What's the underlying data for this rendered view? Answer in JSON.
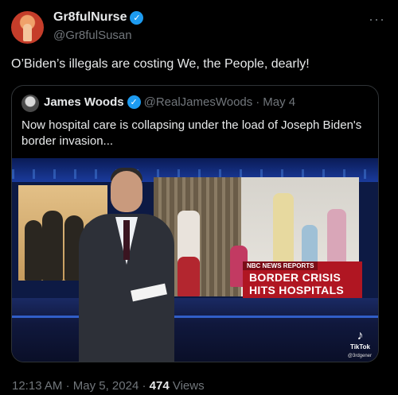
{
  "post": {
    "display_name": "Gr8fulNurse",
    "handle": "@Gr8fulSusan",
    "text": "O’Biden’s illegals are costing We, the People, dearly!",
    "more_icon": "more-dots-icon",
    "verified_icon": "verified-badge-icon",
    "time": "12:13 AM",
    "date": "May 5, 2024",
    "separator": "·",
    "views_count": "474",
    "views_label": "Views"
  },
  "quote": {
    "display_name": "James Woods",
    "handle": "@RealJamesWoods",
    "separator": "·",
    "date": "May 4",
    "text": "Now hospital care is collapsing under the load of Joseph Biden's border invasion...",
    "media": {
      "chyron_tag": "NBC NEWS REPORTS",
      "chyron_line1": "BORDER CRISIS",
      "chyron_line2": "HITS HOSPITALS",
      "watermark": "TikTok",
      "watermark_user": "@3rdgener"
    }
  },
  "colors": {
    "background": "#000000",
    "text_primary": "#e7e9ea",
    "text_secondary": "#71767b",
    "verified_blue": "#1d9bf0",
    "border": "#2f3336",
    "chyron_red": "#b01622"
  }
}
